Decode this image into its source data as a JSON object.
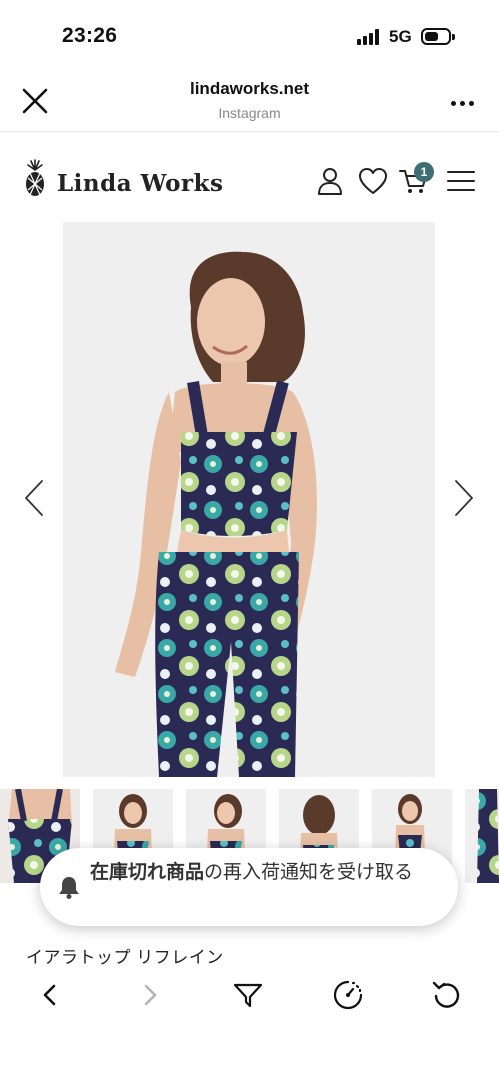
{
  "status_bar": {
    "time": "23:26",
    "network": "5G",
    "battery_level": 0.6
  },
  "browser": {
    "domain": "lindaworks.net",
    "source": "Instagram",
    "icons": {
      "close": "close-icon",
      "more": "more-dots-icon"
    }
  },
  "site_header": {
    "logo_text": "Linda Works",
    "logo_icon": "pineapple-icon",
    "cart_count": "1",
    "icons": [
      "account-icon",
      "heart-icon",
      "cart-icon",
      "menu-icon"
    ]
  },
  "gallery": {
    "prev_icon": "chevron-left-icon",
    "next_icon": "chevron-right-icon",
    "thumbnail_count": 6,
    "colors": {
      "background": "#efefef",
      "navy": "#2b2a55",
      "teal": "#3aa8a6",
      "lime": "#b8d68a"
    }
  },
  "toast": {
    "text_bold": "在庫切れ商品",
    "text_rest": "の再入荷通知を受け取る",
    "icon": "bell-icon"
  },
  "product": {
    "title": "イアラトップ リフレイン"
  },
  "toolbar": {
    "icons": [
      "back-icon",
      "forward-icon",
      "filter-icon",
      "speed-icon",
      "reload-icon"
    ],
    "forward_enabled": false
  },
  "colors": {
    "accent": "#3f6e72",
    "text": "#111111",
    "muted": "#888888"
  }
}
